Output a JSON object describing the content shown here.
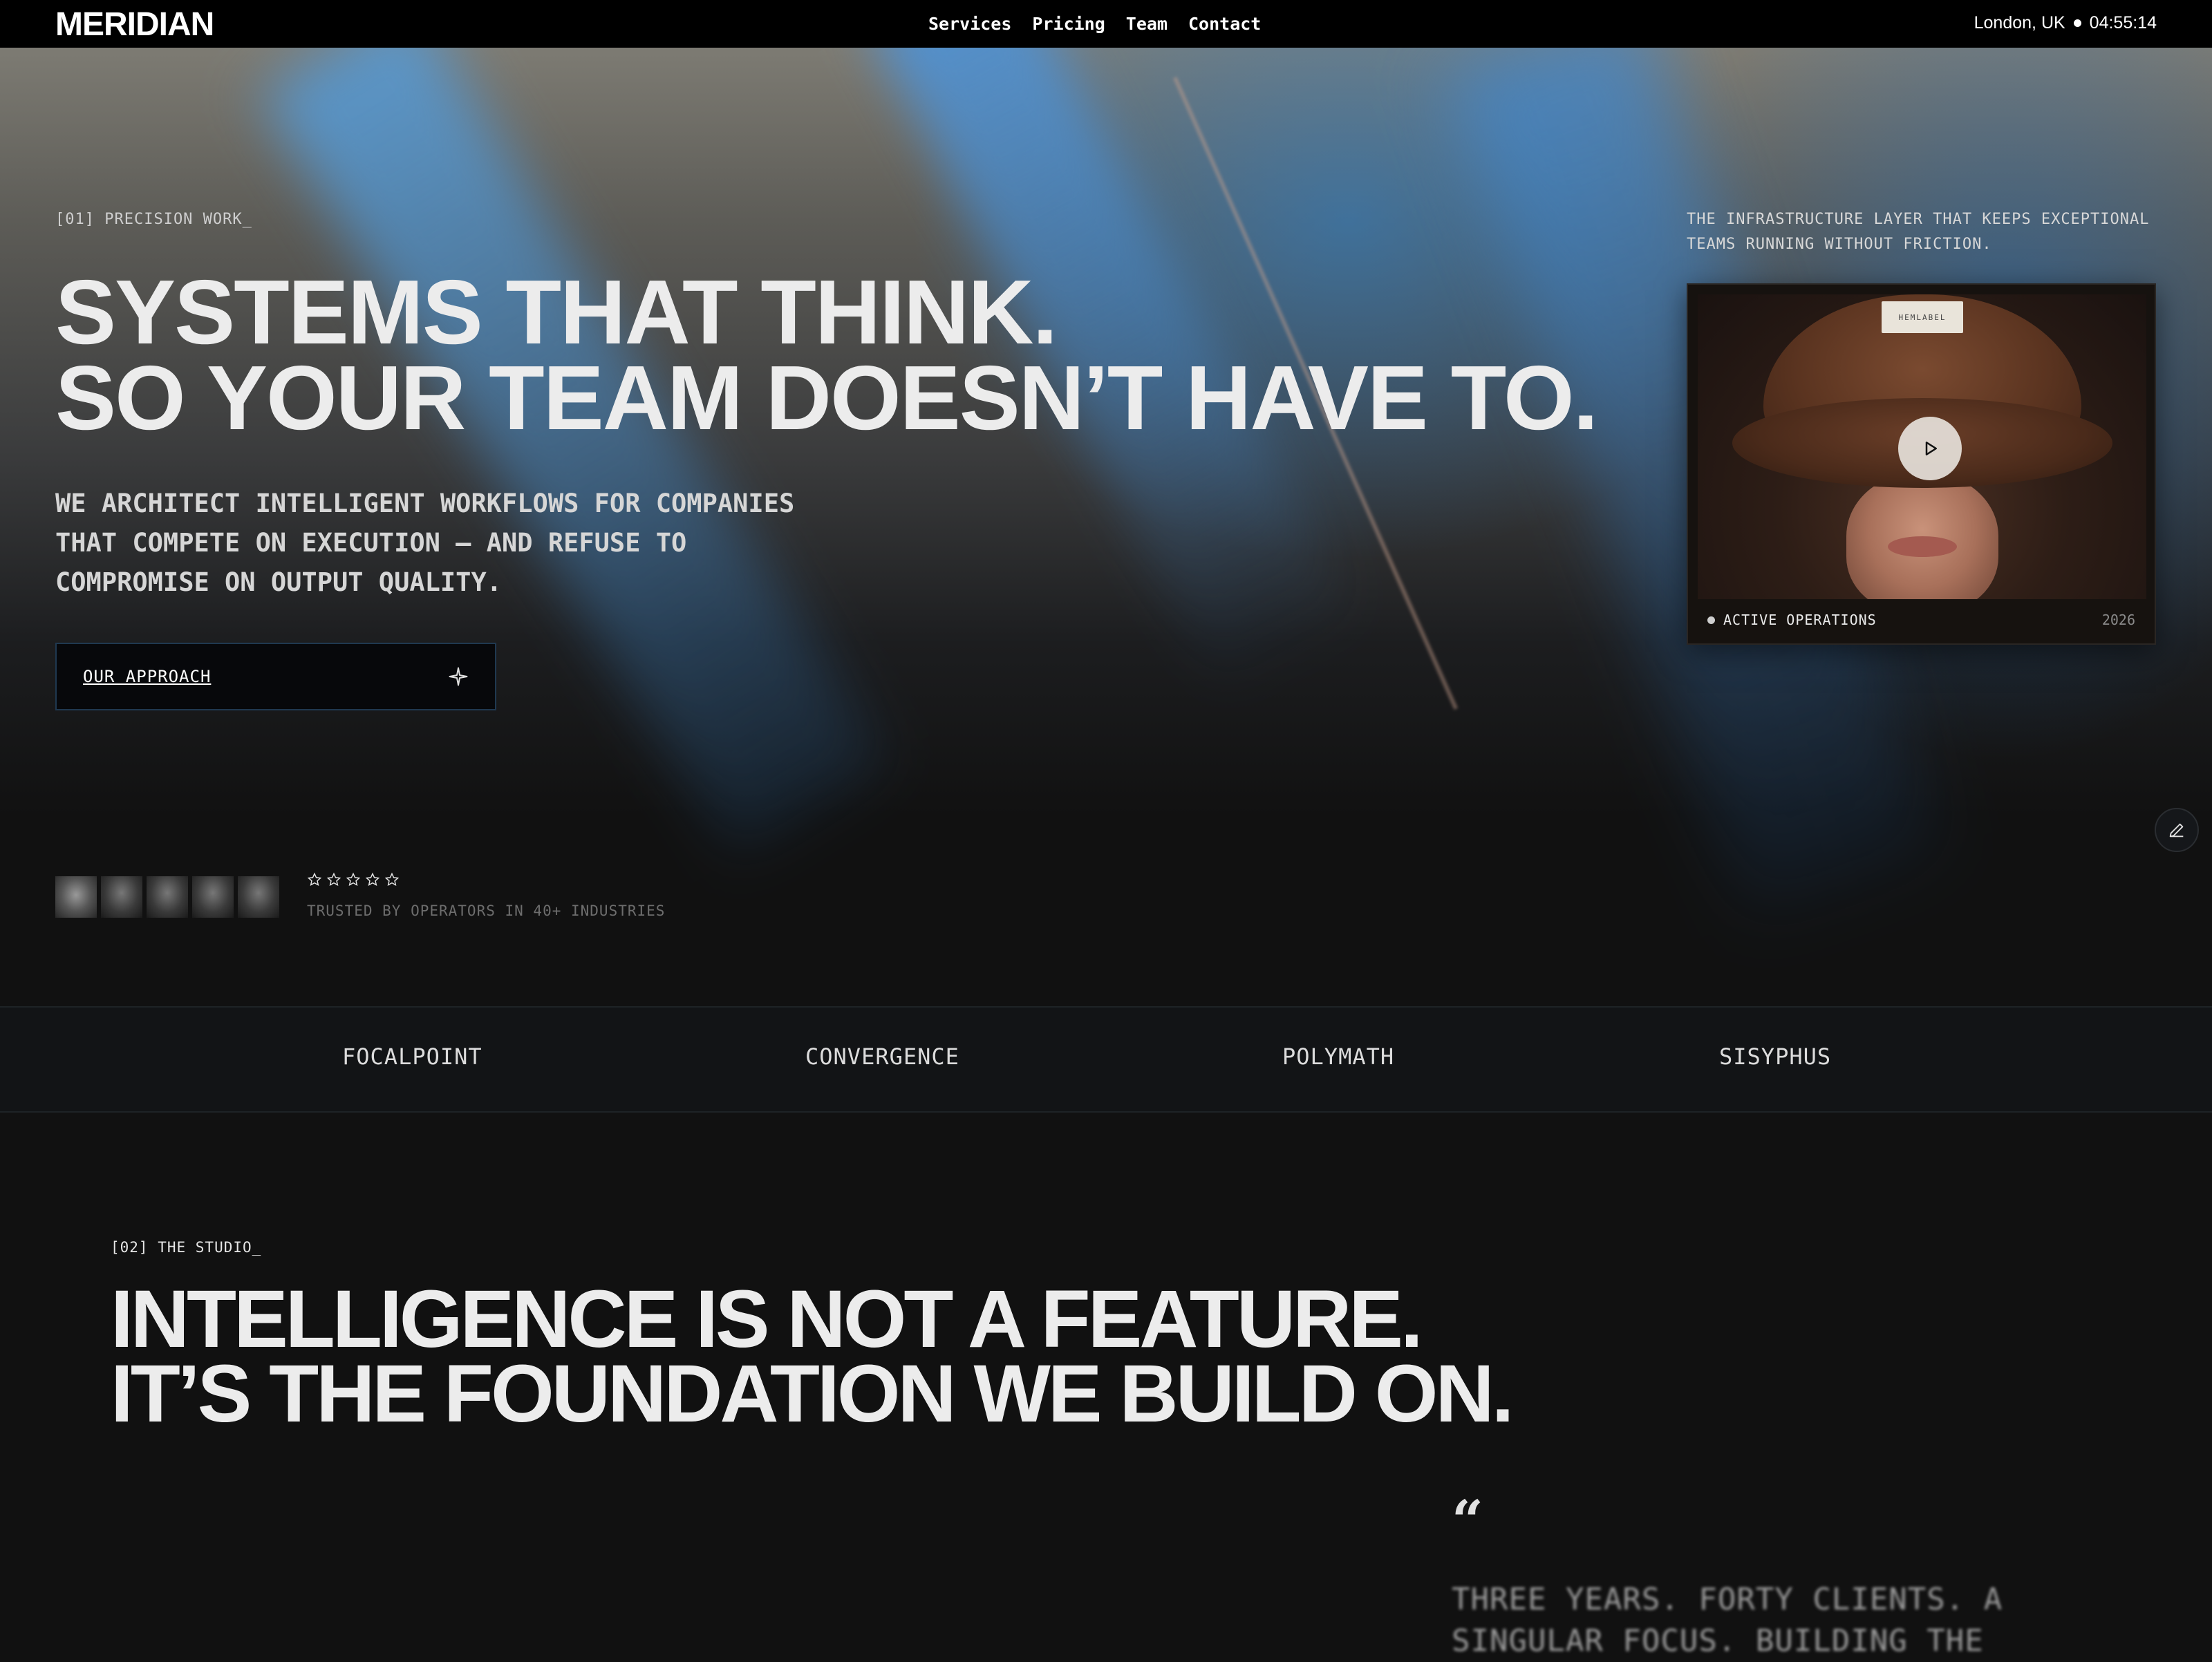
{
  "topbar": {
    "brand": "MERIDIAN",
    "nav": [
      "Services",
      "Pricing",
      "Team",
      "Contact"
    ],
    "location": "London, UK",
    "time": "04:55:14"
  },
  "hero": {
    "eyebrow": "[01] PRECISION WORK_",
    "headline": [
      "SYSTEMS THAT THINK.",
      "SO YOUR TEAM DOESN’T HAVE TO."
    ],
    "subcopy": "WE ARCHITECT INTELLIGENT WORKFLOWS FOR COMPANIES THAT COMPETE ON EXECUTION — AND REFUSE TO COMPROMISE ON OUTPUT QUALITY.",
    "cta_label": "OUR APPROACH",
    "cta_icon": "sparkle-icon",
    "side_note": "THE INFRASTRUCTURE LAYER THAT KEEPS EXCEPTIONAL TEAMS RUNNING WITHOUT FRICTION.",
    "media": {
      "hat_label": "HEMLABEL",
      "status": "ACTIVE OPERATIONS",
      "year": "2026"
    }
  },
  "social_proof": {
    "stars": 5,
    "trusted": "TRUSTED BY OPERATORS IN 40+ INDUSTRIES"
  },
  "logos": [
    "FOCALPOINT",
    "CONVERGENCE",
    "POLYMATH",
    "SISYPHUS"
  ],
  "studio": {
    "eyebrow": "[02] THE STUDIO_",
    "headline": [
      "INTELLIGENCE IS NOT A FEATURE.",
      "IT’S THE FOUNDATION WE BUILD ON."
    ],
    "quote_mark": "“",
    "quote": "THREE YEARS. FORTY CLIENTS. A SINGULAR FOCUS. BUILDING THE"
  },
  "colors": {
    "accent_blue": "#2f86d6",
    "background": "#111111",
    "cta_border": "#1f3850"
  }
}
